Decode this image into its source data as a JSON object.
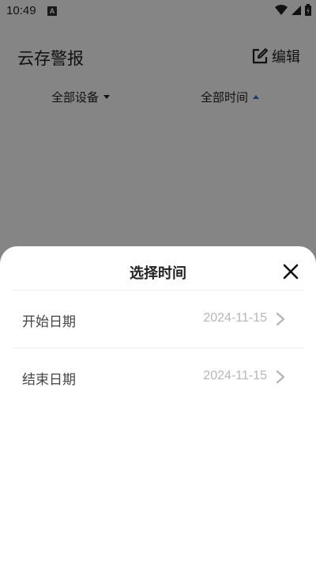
{
  "status_bar": {
    "time": "10:49",
    "notification_icon_letter": "A"
  },
  "header": {
    "title": "云存警报",
    "edit_label": "编辑"
  },
  "filters": {
    "devices_label": "全部设备",
    "time_label": "全部时间"
  },
  "sheet": {
    "title": "选择时间",
    "rows": [
      {
        "label": "开始日期",
        "value": "2024-11-15"
      },
      {
        "label": "结束日期",
        "value": "2024-11-15"
      }
    ]
  },
  "colors": {
    "accent": "#3a6fd8",
    "value_text": "#b6b6b6",
    "overlay": "rgba(0,0,0,0.48)"
  },
  "icons": {
    "edit": "edit-icon",
    "close": "close-icon",
    "chevron": "chevron-right-icon",
    "wifi": "wifi-icon",
    "signal": "signal-icon",
    "battery": "battery-icon"
  }
}
